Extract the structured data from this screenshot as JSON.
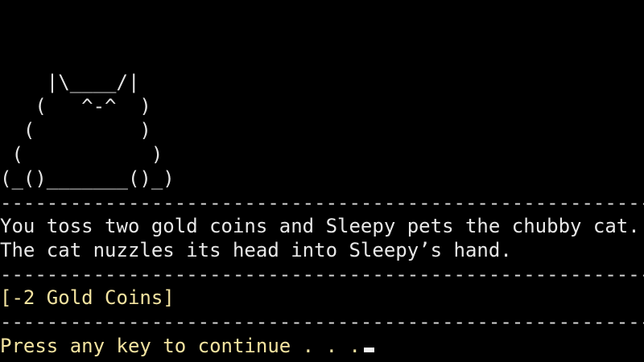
{
  "ascii_art": [
    "    |\\____/|",
    "   (   ^-^  )",
    "  (         )",
    " (           )",
    "(_()_______()_)"
  ],
  "divider": "-------------------------------------------------------------------",
  "message": [
    "You toss two gold coins and Sleepy pets the chubby cat.",
    "The cat nuzzles its head into Sleepy’s hand."
  ],
  "reward": "[-2 Gold Coins]",
  "prompt": "Press any key to continue . . .",
  "colors": {
    "background": "#000000",
    "text": "#e8e8e8",
    "highlight": "#f3e3a0"
  }
}
